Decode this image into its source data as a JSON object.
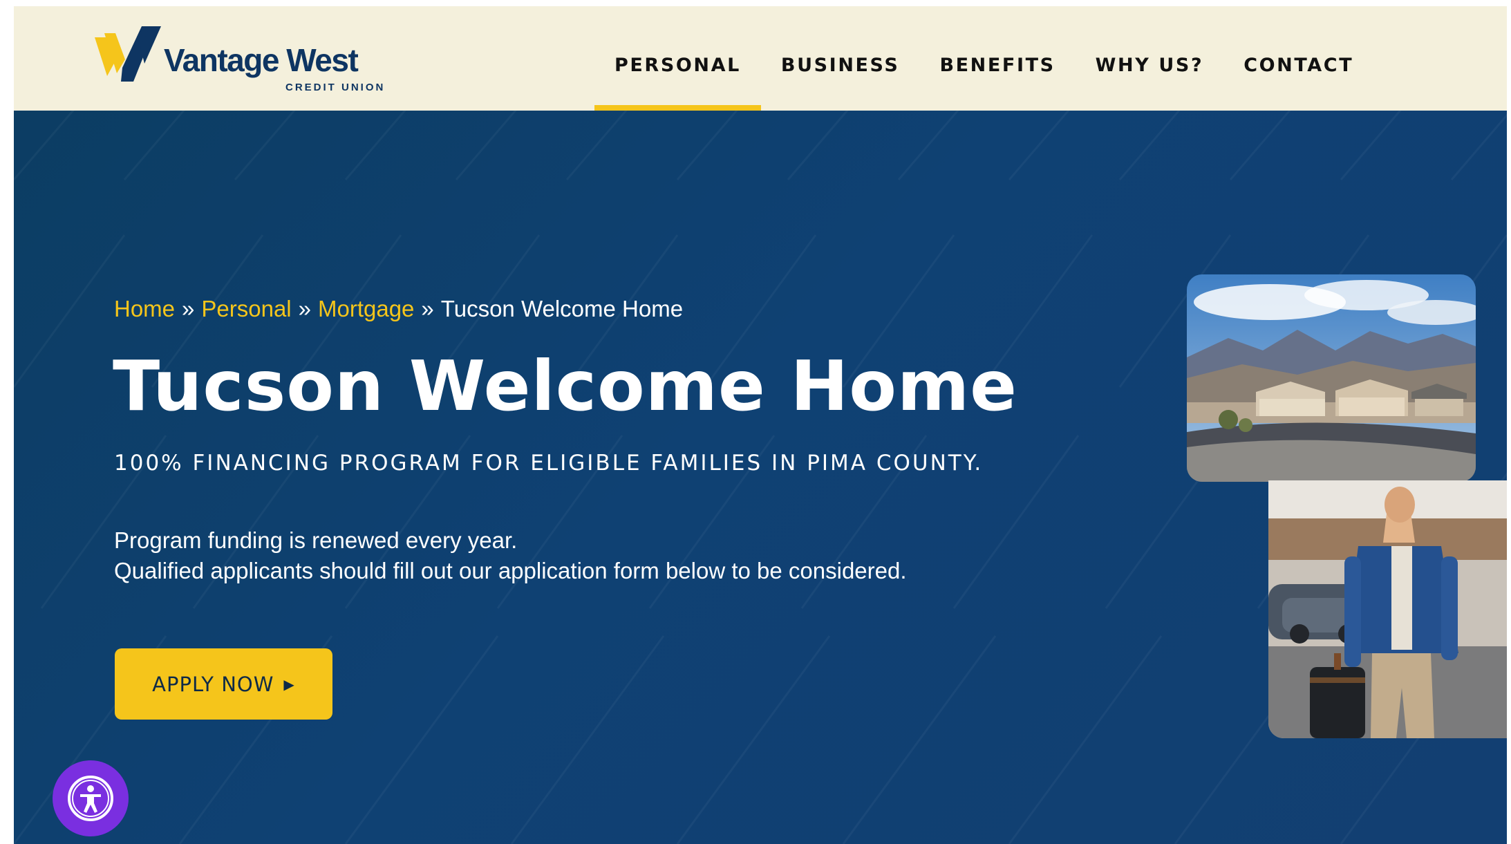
{
  "brand": {
    "name": "Vantage West",
    "subname": "CREDIT UNION",
    "colors": {
      "navy": "#0e3562",
      "gold": "#f5c51b",
      "cream": "#f4f0dc",
      "purple": "#7a2fe0"
    }
  },
  "nav": {
    "items": [
      {
        "label": "PERSONAL",
        "active": true
      },
      {
        "label": "BUSINESS",
        "active": false
      },
      {
        "label": "BENEFITS",
        "active": false
      },
      {
        "label": "WHY US?",
        "active": false
      },
      {
        "label": "CONTACT",
        "active": false
      }
    ]
  },
  "breadcrumb": {
    "items": [
      {
        "label": "Home",
        "link": true
      },
      {
        "label": "Personal",
        "link": true
      },
      {
        "label": "Mortgage",
        "link": true
      },
      {
        "label": "Tucson Welcome Home",
        "link": false
      }
    ],
    "separator": "»"
  },
  "hero": {
    "title": "Tucson Welcome Home",
    "subtitle": "100% FINANCING PROGRAM FOR ELIGIBLE FAMILIES IN PIMA COUNTY.",
    "body_line1": "Program funding is renewed every year.",
    "body_line2": "Qualified applicants should fill out our application form below to be considered.",
    "cta_label": "APPLY NOW",
    "cta_icon": "caret-right-icon"
  },
  "accessibility": {
    "icon": "accessibility-icon"
  }
}
